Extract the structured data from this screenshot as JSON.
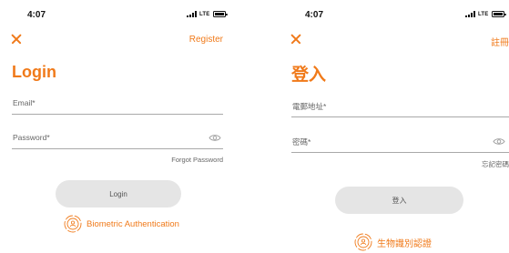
{
  "colors": {
    "accent": "#f07a1a",
    "button_bg": "#e5e5e5",
    "divider": "#a9a9a9"
  },
  "screens": [
    {
      "status": {
        "time": "4:07",
        "network": "LTE"
      },
      "header": {
        "close_icon": "close-icon",
        "register_label": "Register"
      },
      "title": "Login",
      "email": {
        "label": "Email*"
      },
      "password": {
        "label": "Password*",
        "icon": "eye-icon"
      },
      "forgot_label": "Forgot Password",
      "login_label": "Login",
      "biometric": {
        "icon": "biometric-icon",
        "label": "Biometric Authentication"
      }
    },
    {
      "status": {
        "time": "4:07",
        "network": "LTE"
      },
      "header": {
        "close_icon": "close-icon",
        "register_label": "註冊"
      },
      "title": "登入",
      "email": {
        "label": "電郵地址*"
      },
      "password": {
        "label": "密碼*",
        "icon": "eye-icon"
      },
      "forgot_label": "忘記密碼",
      "login_label": "登入",
      "biometric": {
        "icon": "biometric-icon",
        "label": "生物識別認證"
      }
    }
  ]
}
